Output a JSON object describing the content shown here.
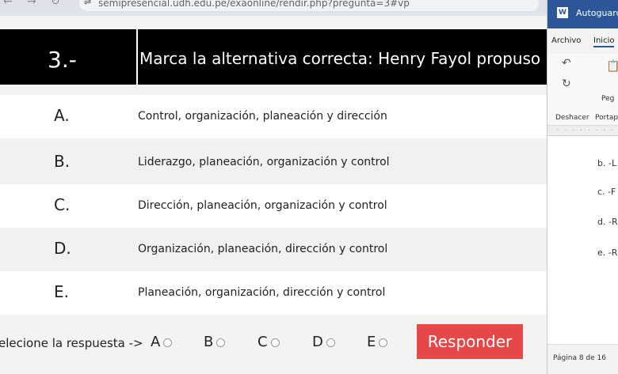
{
  "browser": {
    "back_icon": "arrow-left-icon",
    "forward_icon": "arrow-right-icon",
    "reload_icon": "reload-icon",
    "url": "semipresencial.udh.edu.pe/exaonline/rendir.php?pregunta=3#vp"
  },
  "quiz": {
    "number": "3.-",
    "question": "Marca la alternativa correcta: Henry Fayol propuso un",
    "options": [
      {
        "letter": "A.",
        "text": "Control, organización, planeación y dirección"
      },
      {
        "letter": "B.",
        "text": "Liderazgo, planeación, organización y control"
      },
      {
        "letter": "C.",
        "text": "Dirección, planeación, organización y control"
      },
      {
        "letter": "D.",
        "text": "Organización, planeación, dirección y control"
      },
      {
        "letter": "E.",
        "text": "Planeación, organización, dirección y control"
      }
    ],
    "answer_label": "elecione la respuesta ->",
    "choices": [
      "A",
      "B",
      "C",
      "D",
      "E"
    ],
    "submit_label": "Responder",
    "submit_color": "#e64848"
  },
  "word": {
    "title": "Autoguard",
    "tabs": [
      "Archivo",
      "Inicio"
    ],
    "undo_label": "Deshacer",
    "clipboard_label": "Portap",
    "paste_label": "Peg",
    "doc_lines": [
      "b. -L",
      "c. -F",
      "d. -R",
      "e. -R"
    ],
    "status": "Página 8 de 16",
    "accent": "#2b579a"
  }
}
